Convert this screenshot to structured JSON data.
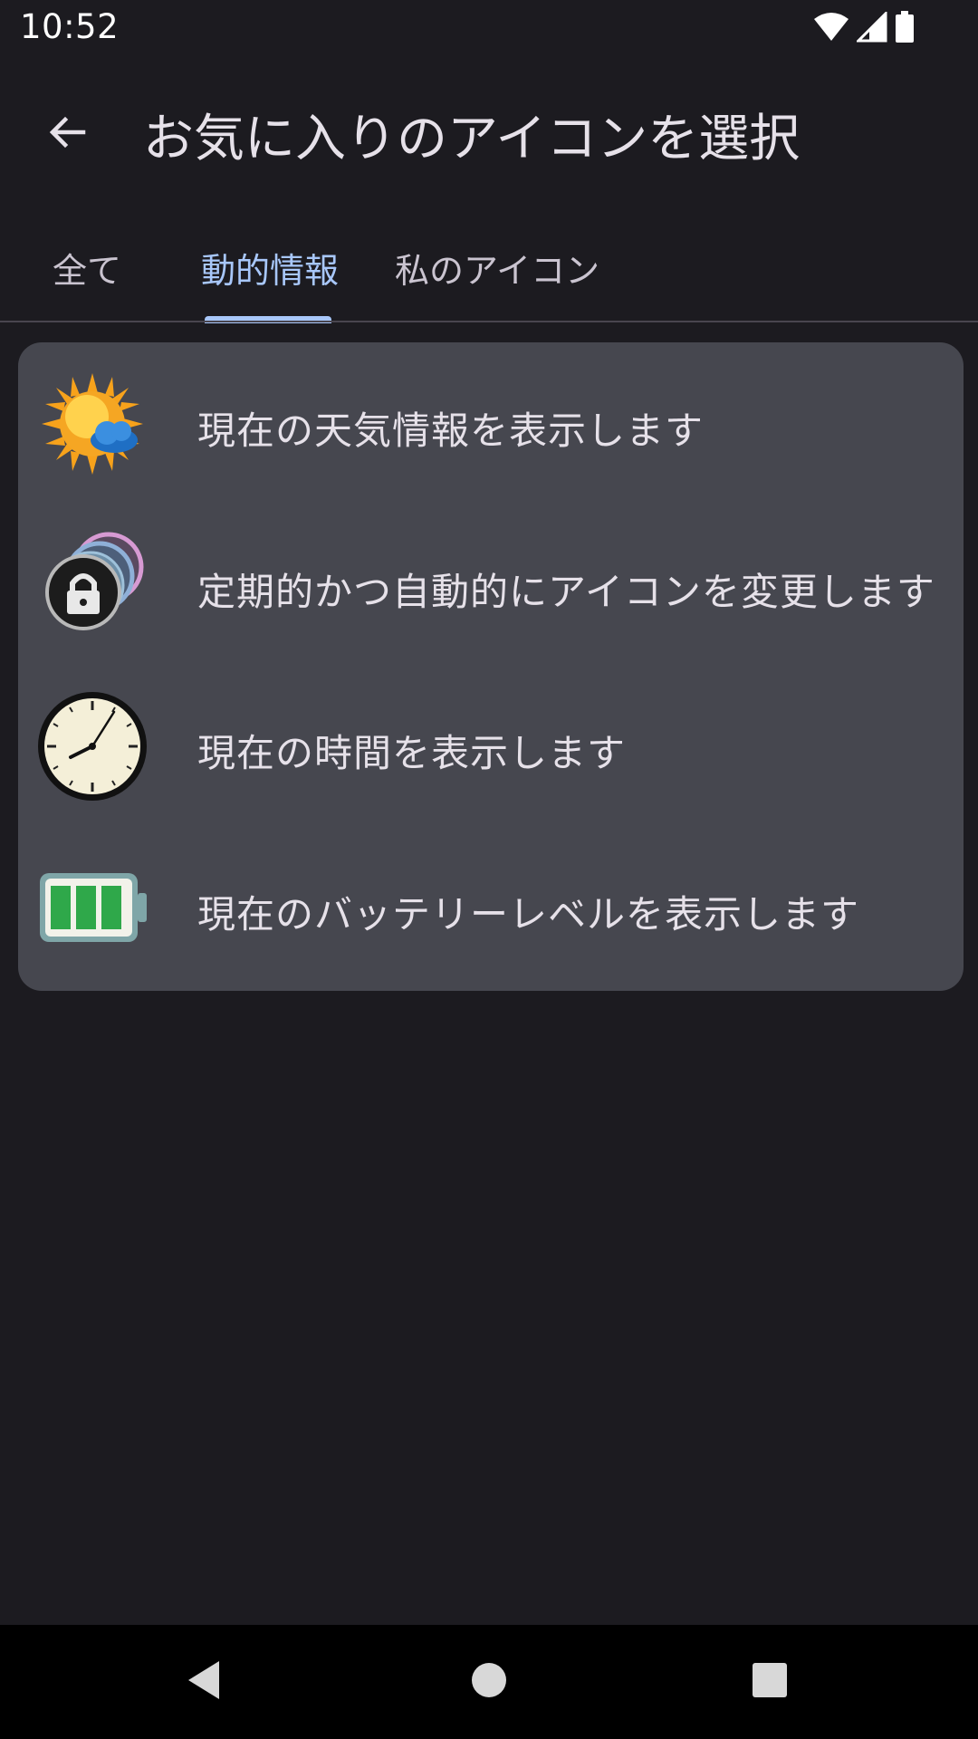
{
  "status_bar": {
    "time": "10:52",
    "icons": [
      "wifi-icon",
      "cell-signal-icon",
      "battery-icon"
    ]
  },
  "app_bar": {
    "title": "お気に入りのアイコンを選択",
    "back_icon": "arrow-back-icon"
  },
  "tabs": {
    "items": [
      {
        "label": "全て",
        "active": false
      },
      {
        "label": "動的情報",
        "active": true
      },
      {
        "label": "私のアイコン",
        "active": false
      }
    ],
    "accent_color": "#a8c7fa"
  },
  "list": {
    "items": [
      {
        "icon": "weather-sun-cloud-icon",
        "label": "現在の天気情報を表示します"
      },
      {
        "icon": "rotating-lock-icons-icon",
        "label": "定期的かつ自動的にアイコンを変更します"
      },
      {
        "icon": "clock-icon",
        "label": "現在の時間を表示します"
      },
      {
        "icon": "battery-level-icon",
        "label": "現在のバッテリーレベルを表示します"
      }
    ]
  },
  "nav_bar": {
    "buttons": [
      "nav-back-icon",
      "nav-home-icon",
      "nav-recents-icon"
    ]
  },
  "colors": {
    "background": "#1c1b20",
    "card": "#46474f",
    "text": "#e6e1e9"
  }
}
